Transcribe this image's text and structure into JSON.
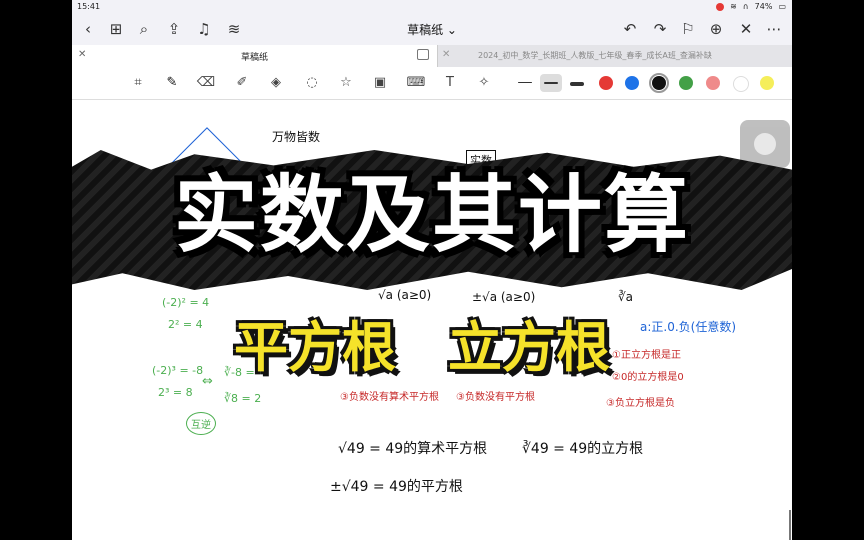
{
  "status": {
    "time": "15:41",
    "battery": "74%"
  },
  "nav": {
    "title": "草稿纸 ⌄"
  },
  "tabs": [
    {
      "title": "草稿纸",
      "active": true
    },
    {
      "title": "2024_初中_数学_长期班_人教版_七年级_春季_成长A班_查漏补缺",
      "active": false
    }
  ],
  "toolbar": {
    "tools": [
      "lasso-ocr-icon",
      "pen-icon",
      "eraser-icon",
      "highlighter-icon",
      "shapes-icon",
      "lasso-icon",
      "sticker-icon",
      "image-icon",
      "keyboard-icon",
      "text-icon",
      "laser-pointer-icon"
    ],
    "stroke_widths": [
      "thin",
      "medium",
      "thick"
    ],
    "colors": [
      "#e53935",
      "#1e73e8",
      "#111111",
      "#43a047",
      "#ef8a8a",
      "#ffffff",
      "#f5ee5a"
    ]
  },
  "overlay": {
    "title": "实数及其计算",
    "subtitle_left": "平方根",
    "subtitle_right": "立方根"
  },
  "notes": {
    "top_label": "万物皆数",
    "boxed_label": "实数",
    "col1": [
      "√a (a≥0)",
      "±√a (a≥0)",
      "∛a"
    ],
    "green_left": [
      "(-2)² = 4",
      "2² = 4",
      "(-2)³ = -8",
      "2³ = 8"
    ],
    "green_mid": [
      "∛-8 = -2",
      "∛8 = 2"
    ],
    "green_arrow": "⇔",
    "green_circle": "互逆",
    "blue_right": "a:正.0.负(任意数)",
    "red_items": [
      "③负数没有算术平方根",
      "③负数没有平方根",
      "③负立方根是负"
    ],
    "red_right_top": [
      "①正立方根是正",
      "②0的立方根是0"
    ],
    "bottom1_left": "√49 = 49的算术平方根",
    "bottom1_right": "∛49 = 49的立方根",
    "bottom2": "±√49 = 49的平方根"
  }
}
